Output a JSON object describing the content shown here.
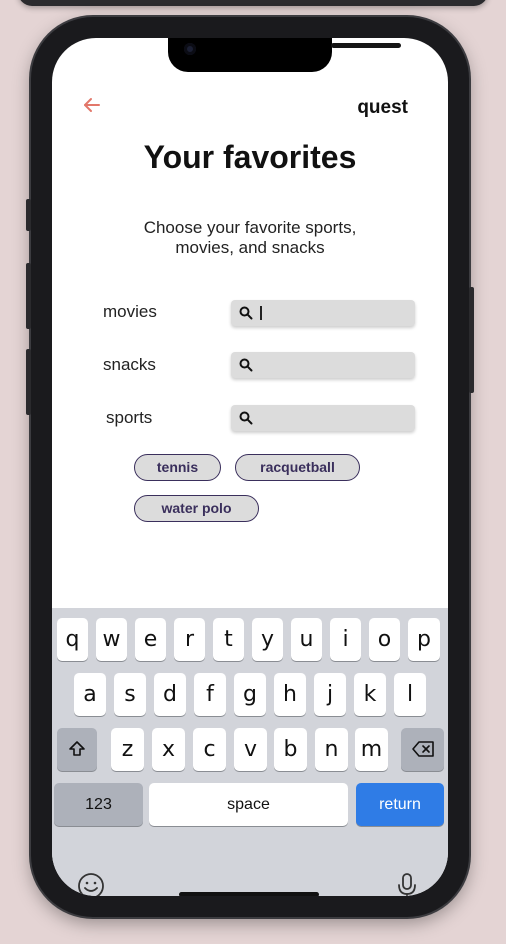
{
  "header": {
    "back_icon": "arrow-left-icon",
    "brand": "quest"
  },
  "title": "Your favorites",
  "subtitle_line1": "Choose your favorite sports,",
  "subtitle_line2": "movies, and snacks",
  "fields": [
    {
      "label": "movies",
      "value": "",
      "focused": true
    },
    {
      "label": "snacks",
      "value": ""
    },
    {
      "label": "sports",
      "value": ""
    }
  ],
  "chips": [
    "tennis",
    "racquetball",
    "water polo"
  ],
  "colors": {
    "accent": "#e2776a",
    "chip_border": "#3a2f5c",
    "return_key": "#2f7ce6"
  },
  "keyboard": {
    "row1": [
      "q",
      "w",
      "e",
      "r",
      "t",
      "y",
      "u",
      "i",
      "o",
      "p"
    ],
    "row2": [
      "a",
      "s",
      "d",
      "f",
      "g",
      "h",
      "j",
      "k",
      "l"
    ],
    "row3": [
      "z",
      "x",
      "c",
      "v",
      "b",
      "n",
      "m"
    ],
    "numbers_label": "123",
    "space_label": "space",
    "return_label": "return",
    "icons": [
      "shift-icon",
      "backspace-icon",
      "emoji-icon",
      "microphone-icon"
    ]
  }
}
